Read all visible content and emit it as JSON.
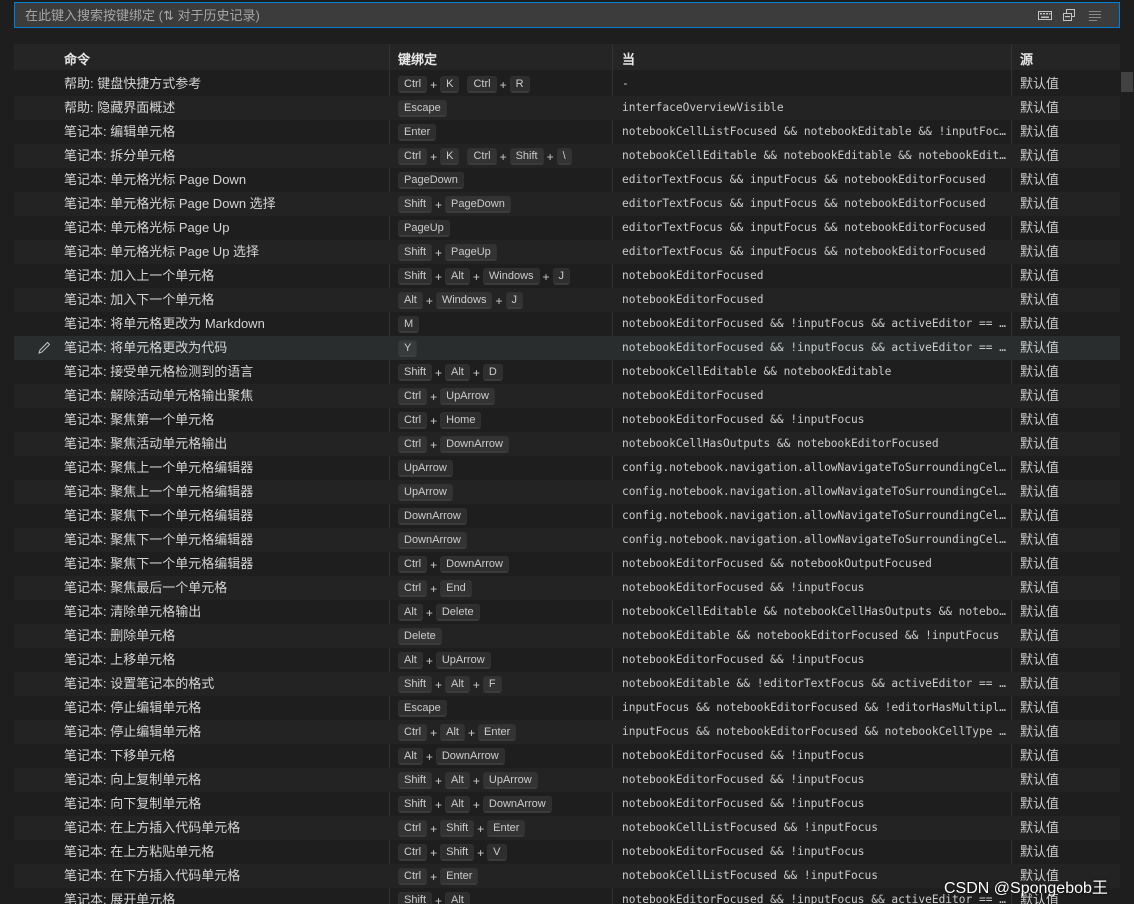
{
  "search": {
    "placeholder": "在此键入搜索按键绑定 (⇅ 对于历史记录)",
    "icons": [
      "keyboard-icon",
      "record-keys-icon",
      "sort-by-precedence-icon"
    ]
  },
  "table": {
    "headers": {
      "command": "命令",
      "keybinding": "键绑定",
      "when": "当",
      "source": "源"
    },
    "rows": [
      {
        "command": "帮助: 键盘快捷方式参考",
        "keys": [
          [
            "Ctrl",
            "K"
          ],
          [
            "Ctrl",
            "R"
          ]
        ],
        "when": "-",
        "source": "默认值"
      },
      {
        "command": "帮助: 隐藏界面概述",
        "keys": [
          [
            "Escape"
          ]
        ],
        "when": "interfaceOverviewVisible",
        "source": "默认值"
      },
      {
        "command": "笔记本: 编辑单元格",
        "keys": [
          [
            "Enter"
          ]
        ],
        "when": "notebookCellListFocused && notebookEditable && !inputFocus",
        "source": "默认值"
      },
      {
        "command": "笔记本: 拆分单元格",
        "keys": [
          [
            "Ctrl",
            "K"
          ],
          [
            "Ctrl",
            "Shift",
            "\\"
          ]
        ],
        "when": "notebookCellEditable && notebookEditable && notebookEditorFocused",
        "source": "默认值"
      },
      {
        "command": "笔记本: 单元格光标 Page Down",
        "keys": [
          [
            "PageDown"
          ]
        ],
        "when": "editorTextFocus && inputFocus && notebookEditorFocused",
        "source": "默认值"
      },
      {
        "command": "笔记本: 单元格光标 Page Down 选择",
        "keys": [
          [
            "Shift",
            "PageDown"
          ]
        ],
        "when": "editorTextFocus && inputFocus && notebookEditorFocused",
        "source": "默认值"
      },
      {
        "command": "笔记本: 单元格光标 Page Up",
        "keys": [
          [
            "PageUp"
          ]
        ],
        "when": "editorTextFocus && inputFocus && notebookEditorFocused",
        "source": "默认值"
      },
      {
        "command": "笔记本: 单元格光标 Page Up 选择",
        "keys": [
          [
            "Shift",
            "PageUp"
          ]
        ],
        "when": "editorTextFocus && inputFocus && notebookEditorFocused",
        "source": "默认值"
      },
      {
        "command": "笔记本: 加入上一个单元格",
        "keys": [
          [
            "Shift",
            "Alt",
            "Windows",
            "J"
          ]
        ],
        "when": "notebookEditorFocused",
        "source": "默认值"
      },
      {
        "command": "笔记本: 加入下一个单元格",
        "keys": [
          [
            "Alt",
            "Windows",
            "J"
          ]
        ],
        "when": "notebookEditorFocused",
        "source": "默认值"
      },
      {
        "command": "笔记本: 将单元格更改为 Markdown",
        "keys": [
          [
            "M"
          ]
        ],
        "when": "notebookEditorFocused && !inputFocus && activeEditor == 'workbench.editor.notebook'",
        "source": "默认值"
      },
      {
        "command": "笔记本: 将单元格更改为代码",
        "keys": [
          [
            "Y"
          ]
        ],
        "when": "notebookEditorFocused && !inputFocus && activeEditor == 'workbench.editor.notebook'",
        "source": "默认值",
        "focused": true
      },
      {
        "command": "笔记本: 接受单元格检测到的语言",
        "keys": [
          [
            "Shift",
            "Alt",
            "D"
          ]
        ],
        "when": "notebookCellEditable && notebookEditable",
        "source": "默认值"
      },
      {
        "command": "笔记本: 解除活动单元格输出聚焦",
        "keys": [
          [
            "Ctrl",
            "UpArrow"
          ]
        ],
        "when": "notebookEditorFocused",
        "source": "默认值"
      },
      {
        "command": "笔记本: 聚焦第一个单元格",
        "keys": [
          [
            "Ctrl",
            "Home"
          ]
        ],
        "when": "notebookEditorFocused && !inputFocus",
        "source": "默认值"
      },
      {
        "command": "笔记本: 聚焦活动单元格输出",
        "keys": [
          [
            "Ctrl",
            "DownArrow"
          ]
        ],
        "when": "notebookCellHasOutputs && notebookEditorFocused",
        "source": "默认值"
      },
      {
        "command": "笔记本: 聚焦上一个单元格编辑器",
        "keys": [
          [
            "UpArrow"
          ]
        ],
        "when": "config.notebook.navigation.allowNavigateToSurroundingCells && notebookEditorFocused",
        "source": "默认值"
      },
      {
        "command": "笔记本: 聚焦上一个单元格编辑器",
        "keys": [
          [
            "UpArrow"
          ]
        ],
        "when": "config.notebook.navigation.allowNavigateToSurroundingCells && notebookEditorFocused",
        "source": "默认值"
      },
      {
        "command": "笔记本: 聚焦下一个单元格编辑器",
        "keys": [
          [
            "DownArrow"
          ]
        ],
        "when": "config.notebook.navigation.allowNavigateToSurroundingCells && notebookEditorFocused",
        "source": "默认值"
      },
      {
        "command": "笔记本: 聚焦下一个单元格编辑器",
        "keys": [
          [
            "DownArrow"
          ]
        ],
        "when": "config.notebook.navigation.allowNavigateToSurroundingCells && notebookEditorFocused",
        "source": "默认值"
      },
      {
        "command": "笔记本: 聚焦下一个单元格编辑器",
        "keys": [
          [
            "Ctrl",
            "DownArrow"
          ]
        ],
        "when": "notebookEditorFocused && notebookOutputFocused",
        "source": "默认值"
      },
      {
        "command": "笔记本: 聚焦最后一个单元格",
        "keys": [
          [
            "Ctrl",
            "End"
          ]
        ],
        "when": "notebookEditorFocused && !inputFocus",
        "source": "默认值"
      },
      {
        "command": "笔记本: 清除单元格输出",
        "keys": [
          [
            "Alt",
            "Delete"
          ]
        ],
        "when": "notebookCellEditable && notebookCellHasOutputs && notebookEditable",
        "source": "默认值"
      },
      {
        "command": "笔记本: 删除单元格",
        "keys": [
          [
            "Delete"
          ]
        ],
        "when": "notebookEditable && notebookEditorFocused && !inputFocus",
        "source": "默认值"
      },
      {
        "command": "笔记本: 上移单元格",
        "keys": [
          [
            "Alt",
            "UpArrow"
          ]
        ],
        "when": "notebookEditorFocused && !inputFocus",
        "source": "默认值"
      },
      {
        "command": "笔记本: 设置笔记本的格式",
        "keys": [
          [
            "Shift",
            "Alt",
            "F"
          ]
        ],
        "when": "notebookEditable && !editorTextFocus && activeEditor == 'workbench.editor.notebook'",
        "source": "默认值"
      },
      {
        "command": "笔记本: 停止编辑单元格",
        "keys": [
          [
            "Escape"
          ]
        ],
        "when": "inputFocus && notebookEditorFocused && !editorHasMultipleSelections",
        "source": "默认值"
      },
      {
        "command": "笔记本: 停止编辑单元格",
        "keys": [
          [
            "Ctrl",
            "Alt",
            "Enter"
          ]
        ],
        "when": "inputFocus && notebookEditorFocused && notebookCellType == 'markup'",
        "source": "默认值"
      },
      {
        "command": "笔记本: 下移单元格",
        "keys": [
          [
            "Alt",
            "DownArrow"
          ]
        ],
        "when": "notebookEditorFocused && !inputFocus",
        "source": "默认值"
      },
      {
        "command": "笔记本: 向上复制单元格",
        "keys": [
          [
            "Shift",
            "Alt",
            "UpArrow"
          ]
        ],
        "when": "notebookEditorFocused && !inputFocus",
        "source": "默认值"
      },
      {
        "command": "笔记本: 向下复制单元格",
        "keys": [
          [
            "Shift",
            "Alt",
            "DownArrow"
          ]
        ],
        "when": "notebookEditorFocused && !inputFocus",
        "source": "默认值"
      },
      {
        "command": "笔记本: 在上方插入代码单元格",
        "keys": [
          [
            "Ctrl",
            "Shift",
            "Enter"
          ]
        ],
        "when": "notebookCellListFocused && !inputFocus",
        "source": "默认值"
      },
      {
        "command": "笔记本: 在上方粘贴单元格",
        "keys": [
          [
            "Ctrl",
            "Shift",
            "V"
          ]
        ],
        "when": "notebookEditorFocused && !inputFocus",
        "source": "默认值"
      },
      {
        "command": "笔记本: 在下方插入代码单元格",
        "keys": [
          [
            "Ctrl",
            "Enter"
          ]
        ],
        "when": "notebookCellListFocused && !inputFocus",
        "source": "默认值"
      },
      {
        "command": "笔记本: 展开单元格",
        "keys": [
          [
            "Shift",
            "Alt"
          ]
        ],
        "when": "notebookEditorFocused && !inputFocus && activeEditor == 'workbench.editor.notebook'",
        "source": "默认值"
      }
    ]
  },
  "watermark": "CSDN @Spongebob王"
}
